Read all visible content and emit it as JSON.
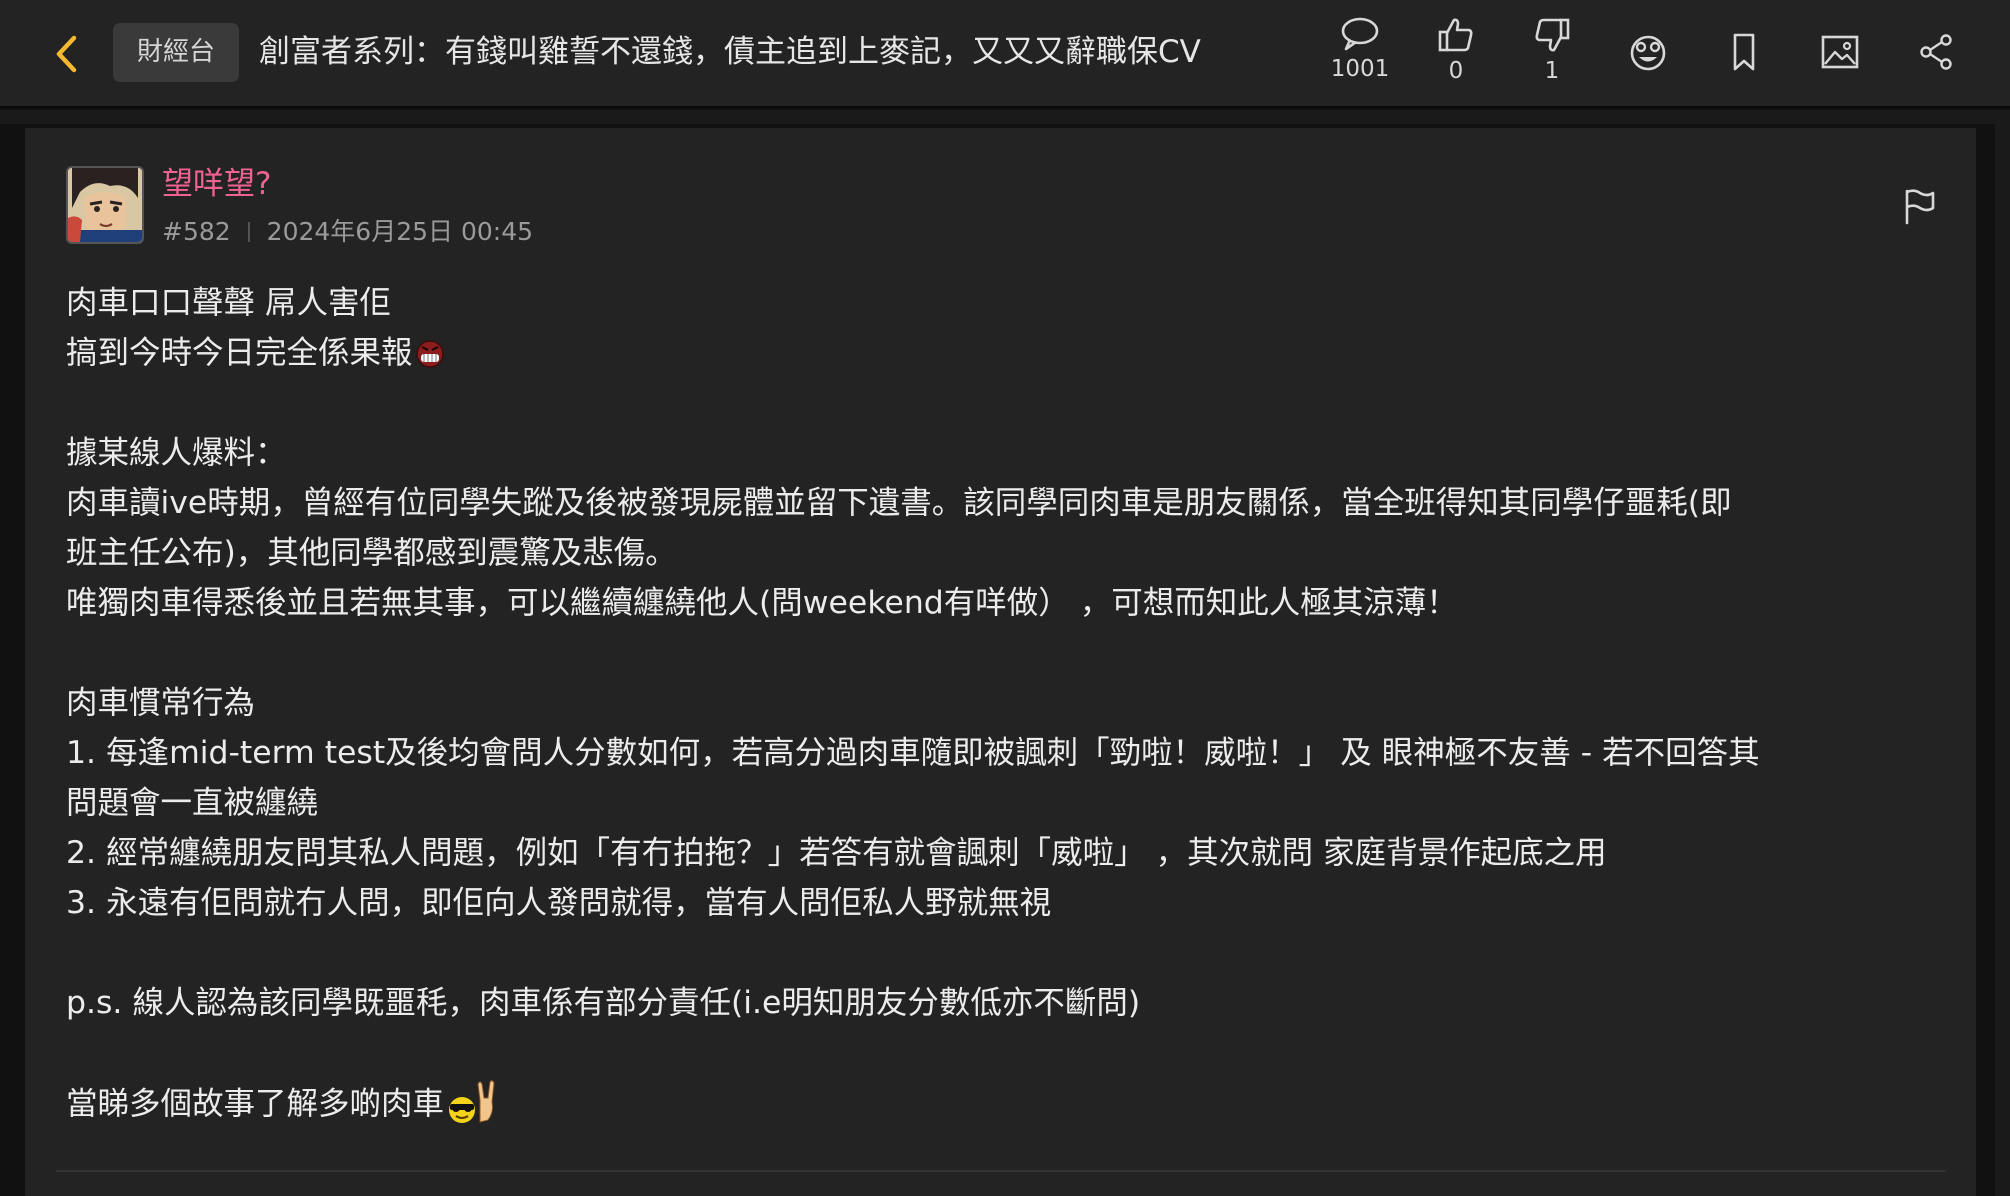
{
  "header": {
    "back_icon": "chevron-left-icon",
    "channel": "財經台",
    "title": "創富者系列：有錢叫雞誓不還錢，債主追到上麥記，又又又辭職保CV",
    "accent_color": "#f5b82e",
    "tools": {
      "reply_count": "1001",
      "like_count": "0",
      "dislike_count": "1",
      "icons": [
        "comment-icon",
        "thumbs-up-icon",
        "thumbs-down-icon",
        "emoji-face-icon",
        "bookmark-icon",
        "image-icon",
        "share-icon"
      ]
    }
  },
  "post": {
    "username": "望咩望?",
    "username_color": "#f06292",
    "floor": "#582",
    "timestamp": "2024年6月25日 00:45",
    "lines": [
      "肉車口口聲聲 屌人害佢",
      "搞到今時今日完全係果報",
      "",
      "據某線人爆料：",
      "肉車讀ive時期，曾經有位同學失蹤及後被發現屍體並留下遺書。該同學同肉車是朋友關係，當全班得知其同學仔噩耗(即",
      "班主任公布)，其他同學都感到震驚及悲傷。",
      "唯獨肉車得悉後並且若無其事，可以繼續纏繞他人(問weekend有咩做）  ，可想而知此人極其涼薄！",
      "",
      "肉車慣常行為",
      "1. 每逢mid-term test及後均會問人分數如何，若高分過肉車隨即被諷刺「勁啦！威啦！」 及 眼神極不友善 - 若不回答其",
      "問題會一直被纏繞",
      "2. 經常纏繞朋友問其私人問題，例如「有冇拍拖？」若答有就會諷刺「威啦」 ，其次就問 家庭背景作起底之用",
      "3. 永遠有佢問就冇人問，即佢向人發問就得，當有人問佢私人野就無視",
      "",
      "p.s. 線人認為該同學既噩秏，肉車係有部分責任(i.e明知朋友分數低亦不斷問)",
      "",
      "當睇多個故事了解多啲肉車"
    ],
    "emoji_icons": [
      "angry-face-emoji-icon",
      "sunglasses-rock-hand-emoji-icon"
    ]
  }
}
